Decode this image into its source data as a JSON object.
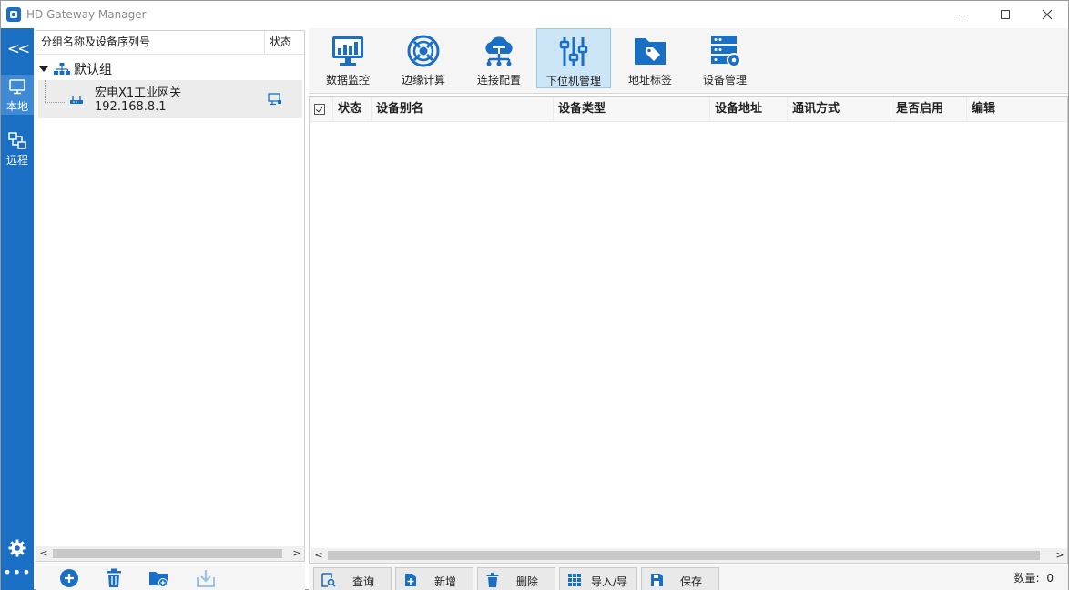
{
  "window": {
    "title": "HD Gateway Manager"
  },
  "colors": {
    "accent": "#1a6fc4",
    "rail_active": "#3f8ad6",
    "ribbon_active": "#cde6f7"
  },
  "rail": {
    "collapse_glyph": "<<",
    "items": [
      {
        "label": "本地",
        "icon": "monitor-icon",
        "active": true
      },
      {
        "label": "远程",
        "icon": "remote-network-icon",
        "active": false
      }
    ],
    "settings_icon": "gear-icon",
    "more_glyph": "•••"
  },
  "tree": {
    "header": {
      "name_col": "分组名称及设备序列号",
      "status_col": "状态"
    },
    "group": {
      "label": "默认组",
      "icon": "org-tree-icon"
    },
    "device": {
      "name": "宏电X1工业网关",
      "ip": "192.168.8.1",
      "icon": "router-icon",
      "status_icon": "monitor-status-icon"
    },
    "toolbar": [
      "add-circle-icon",
      "trash-icon",
      "add-folder-icon",
      "import-download-icon"
    ]
  },
  "ribbon": {
    "buttons": [
      {
        "label": "数据监控",
        "icon": "monitor-chart-icon",
        "active": false
      },
      {
        "label": "边缘计算",
        "icon": "edge-compute-icon",
        "active": false
      },
      {
        "label": "连接配置",
        "icon": "cloud-connect-icon",
        "active": false
      },
      {
        "label": "下位机管理",
        "icon": "sliders-icon",
        "active": true
      },
      {
        "label": "地址标签",
        "icon": "folder-tag-icon",
        "active": false
      },
      {
        "label": "设备管理",
        "icon": "server-gear-icon",
        "active": false
      }
    ]
  },
  "grid": {
    "columns": [
      "状态",
      "设备别名",
      "设备类型",
      "设备地址",
      "通讯方式",
      "是否启用",
      "编辑"
    ],
    "rows": []
  },
  "actions": {
    "buttons": [
      {
        "label": "查询",
        "icon": "search-doc-icon"
      },
      {
        "label": "新增",
        "icon": "add-doc-icon"
      },
      {
        "label": "删除",
        "icon": "trash-icon"
      },
      {
        "label": "导入/导出",
        "icon": "grid-icon"
      },
      {
        "label": "保存",
        "icon": "save-icon"
      }
    ],
    "count_label": "数量:",
    "count_value": "0"
  }
}
